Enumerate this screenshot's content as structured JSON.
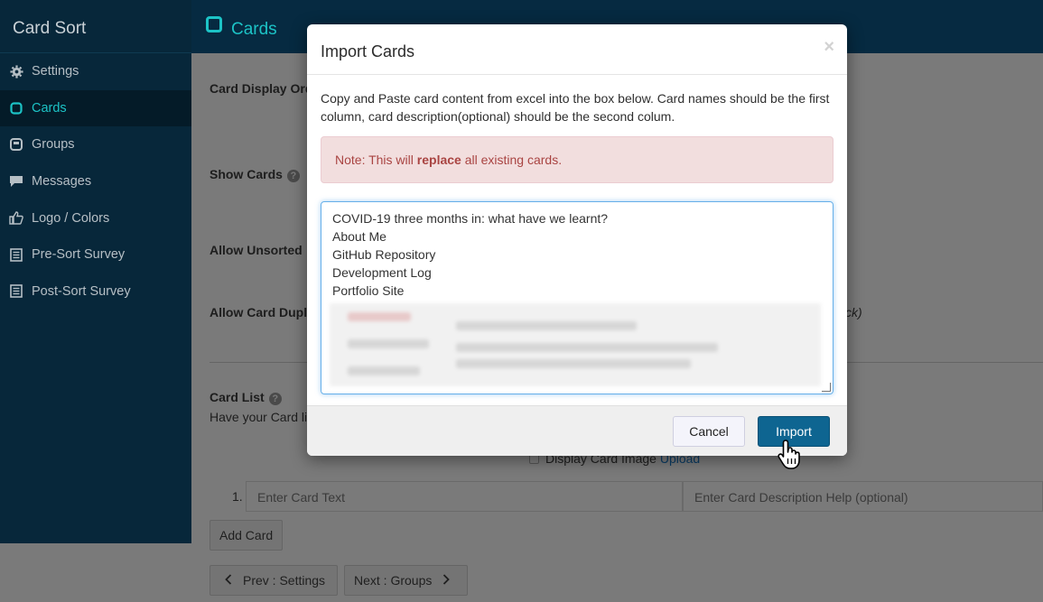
{
  "app": {
    "title": "Card Sort"
  },
  "sidebar": {
    "items": [
      {
        "label": "Settings",
        "icon": "gear-icon"
      },
      {
        "label": "Cards",
        "icon": "square-icon",
        "active": true
      },
      {
        "label": "Groups",
        "icon": "window-icon"
      },
      {
        "label": "Messages",
        "icon": "speech-bubble-icon"
      },
      {
        "label": "Logo / Colors",
        "icon": "thumbs-up-icon"
      },
      {
        "label": "Pre-Sort Survey",
        "icon": "list-icon"
      },
      {
        "label": "Post-Sort Survey",
        "icon": "list-icon"
      }
    ]
  },
  "header": {
    "title": "Cards"
  },
  "main": {
    "card_display_order_label": "Card Display Ord",
    "show_cards_label": "Show Cards",
    "allow_unsorted_label": "Allow Unsorted",
    "allow_card_dup_label": "Allow Card Dupl",
    "allow_card_dup_tail": "ck)",
    "card_list_label": "Card List",
    "card_list_desc": "Have your Card li",
    "display_card_image_label": "Display Card Image",
    "upload_link": "Upload",
    "row_number": "1.",
    "card_text_placeholder": "Enter Card Text",
    "card_desc_placeholder": "Enter Card Description Help (optional)",
    "add_card_label": "Add Card",
    "prev_label": "Prev : Settings",
    "next_label": "Next : Groups"
  },
  "modal": {
    "title": "Import Cards",
    "close": "×",
    "description": "Copy and Paste card content from excel into the box below. Card names should be the first column, card description(optional) should be the second colum.",
    "alert_prefix": "Note: This will ",
    "alert_bold": "replace",
    "alert_suffix": " all existing cards.",
    "textarea_lines": [
      "COVID-19 three months in: what have we learnt?",
      "About Me",
      "GitHub Repository",
      "Development Log",
      "Portfolio Site"
    ],
    "cancel_label": "Cancel",
    "import_label": "Import"
  },
  "colors": {
    "sidebar_bg": "#07273a",
    "accent": "#1cc3c6",
    "primary_button": "#0e6591",
    "alert_bg": "#f2dede",
    "alert_text": "#a94442"
  }
}
